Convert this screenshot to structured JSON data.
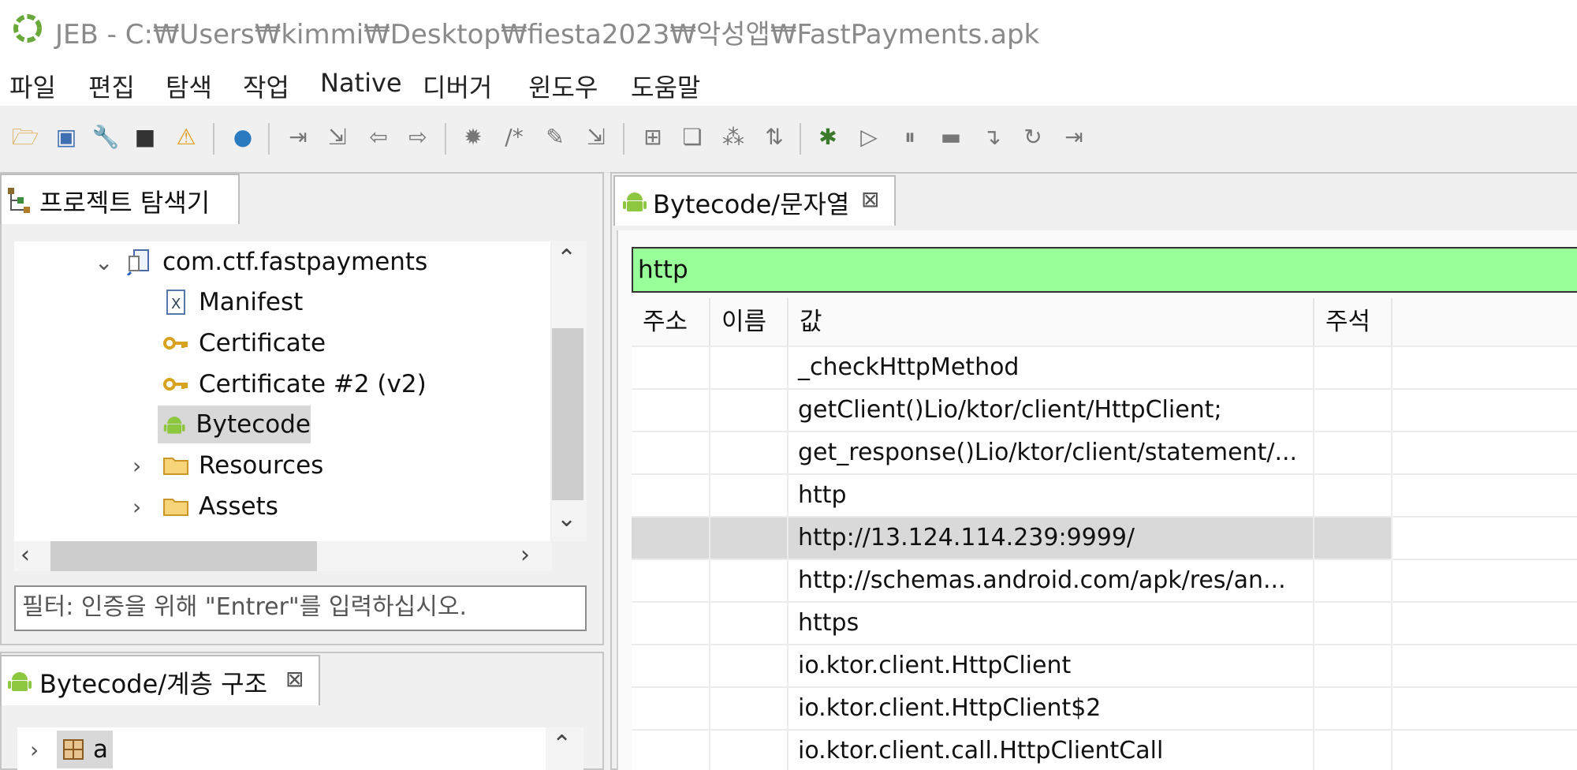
{
  "window": {
    "title": "JEB - C:₩Users₩kimmi₩Desktop₩fiesta2023₩악성앱₩FastPayments.apk"
  },
  "menu": [
    "파일",
    "편집",
    "탐색",
    "작업",
    "Native",
    "디버거",
    "윈도우",
    "도움말"
  ],
  "toolbar": {
    "icons": [
      "open-folder-icon",
      "save-icon",
      "wrench-icon",
      "stop-icon",
      "warning-icon",
      "globe-icon",
      "step-in-icon",
      "step-over-icon",
      "back-arrow-icon",
      "forward-arrow-icon",
      "brain-icon",
      "comment-icon",
      "pencil-icon",
      "import-icon",
      "grid-icon",
      "classes-icon",
      "hierarchy-icon",
      "sort-icon",
      "bug-icon",
      "resume-icon",
      "pause-icon",
      "terminate-icon",
      "step-into-icon",
      "step-return-icon",
      "run-to-line-icon"
    ]
  },
  "project_explorer": {
    "tab_label": "프로젝트 탐색기",
    "tree": [
      {
        "label": "com.ctf.fastpayments",
        "icon": "apk-icon",
        "twisty": "expanded"
      },
      {
        "label": "Manifest",
        "icon": "xml-file-icon",
        "twisty": ""
      },
      {
        "label": "Certificate",
        "icon": "key-icon",
        "twisty": ""
      },
      {
        "label": "Certificate #2 (v2)",
        "icon": "key-icon",
        "twisty": ""
      },
      {
        "label": "Bytecode",
        "icon": "android-icon",
        "twisty": "",
        "selected": true
      },
      {
        "label": "Resources",
        "icon": "folder-icon",
        "twisty": "collapsed"
      },
      {
        "label": "Assets",
        "icon": "folder-icon",
        "twisty": "collapsed"
      }
    ],
    "filter_placeholder": "필터: 인증을 위해 \"Entrer\"를 입력하십시오."
  },
  "hierarchy": {
    "tab_label": "Bytecode/계층 구조",
    "items": [
      {
        "label": "a",
        "icon": "package-icon"
      }
    ]
  },
  "strings_view": {
    "tab_label": "Bytecode/문자열",
    "search_value": "http",
    "search_bg": "#99ff99",
    "columns": [
      "주소",
      "이름",
      "값",
      "주석"
    ],
    "rows": [
      {
        "address": "",
        "name": "",
        "value": "_checkHttpMethod",
        "comment": ""
      },
      {
        "address": "",
        "name": "",
        "value": "getClient()Lio/ktor/client/HttpClient;",
        "comment": ""
      },
      {
        "address": "",
        "name": "",
        "value": "get_response()Lio/ktor/client/statement/...",
        "comment": ""
      },
      {
        "address": "",
        "name": "",
        "value": "http",
        "comment": ""
      },
      {
        "address": "",
        "name": "",
        "value": "http://13.124.114.239:9999/",
        "comment": "",
        "highlighted": true
      },
      {
        "address": "",
        "name": "",
        "value": "http://schemas.android.com/apk/res/an...",
        "comment": ""
      },
      {
        "address": "",
        "name": "",
        "value": "https",
        "comment": ""
      },
      {
        "address": "",
        "name": "",
        "value": "io.ktor.client.HttpClient",
        "comment": ""
      },
      {
        "address": "",
        "name": "",
        "value": "io.ktor.client.HttpClient$2",
        "comment": ""
      },
      {
        "address": "",
        "name": "",
        "value": "io.ktor.client.call.HttpClientCall",
        "comment": ""
      }
    ]
  },
  "colors": {
    "accent_green": "#99ff99",
    "android_green": "#8dc63f",
    "selection": "#d8d8d8"
  }
}
